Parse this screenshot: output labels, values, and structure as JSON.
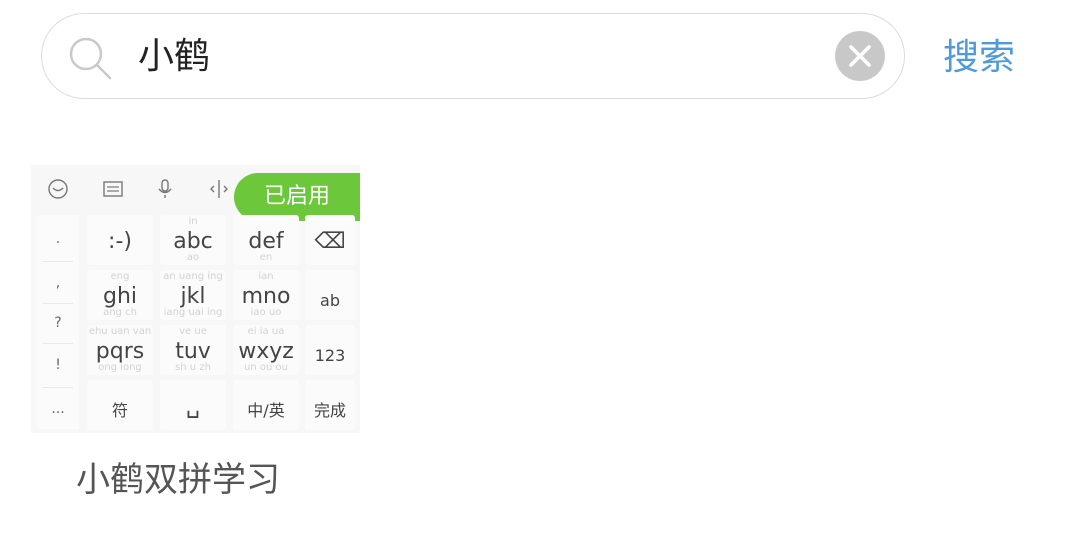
{
  "search": {
    "query": "小鹤",
    "search_button": "搜索"
  },
  "result": {
    "badge": "已启用",
    "app_name": "小鹤双拼学习",
    "keyboard": {
      "left_column": [
        ".",
        ",",
        "?",
        "!",
        "..."
      ],
      "keys": [
        {
          "main": ":-)",
          "sup": "",
          "sub": ""
        },
        {
          "main": "abc",
          "sup": "in",
          "sub": "ao"
        },
        {
          "main": "def",
          "sup": "",
          "sub": "en"
        },
        {
          "main": "ghi",
          "sup": "eng",
          "sub": "ang ch"
        },
        {
          "main": "jkl",
          "sup": "an uang ing",
          "sub": "iang uai ing"
        },
        {
          "main": "mno",
          "sup": "ian",
          "sub": "iao uo"
        },
        {
          "main": "pqrs",
          "sup": "ehu uan van",
          "sub": "ong iong"
        },
        {
          "main": "tuv",
          "sup": "ve ue",
          "sub": "sh u zh"
        },
        {
          "main": "wxyz",
          "sup": "ei ia ua",
          "sub": "un ou ou"
        },
        {
          "main": "符",
          "sup": "",
          "sub": ""
        },
        {
          "main": "␣",
          "sup": "",
          "sub": ""
        },
        {
          "main": "中/英",
          "sup": "",
          "sub": ""
        }
      ],
      "right_column": [
        "⌫",
        "ab",
        "123",
        "完成"
      ],
      "toolbar_icons": [
        "emoji-icon",
        "keyboard-icon",
        "microphone-icon",
        "cursor-icon"
      ]
    }
  },
  "colors": {
    "accent_blue": "#4f9bd9",
    "badge_green": "#6cc73a"
  }
}
